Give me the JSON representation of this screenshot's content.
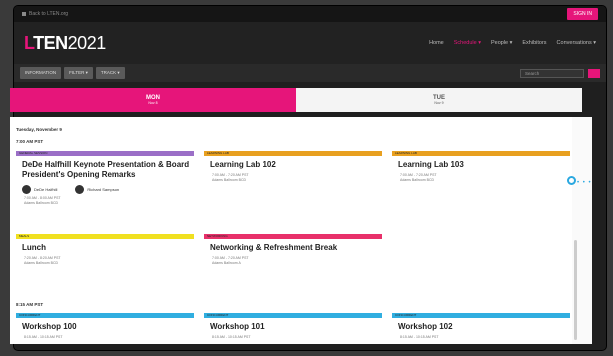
{
  "topbar": {
    "site_label": "Back to LTEN.org",
    "signin_label": "SIGN IN"
  },
  "logo": {
    "prefix": "LTEN",
    "year": "2021"
  },
  "nav": {
    "items": [
      "Home",
      "Schedule ▾",
      "People ▾",
      "Exhibitors",
      "Conversations ▾"
    ]
  },
  "filters": {
    "buttons": [
      "INFORMATION",
      "FILTER ▾",
      "TRACK ▾"
    ],
    "search_placeholder": "Search"
  },
  "days": [
    {
      "label": "MON",
      "sub": "Nov 8"
    },
    {
      "label": "TUE",
      "sub": "Nov 9"
    }
  ],
  "schedule": {
    "date_header": "Tuesday, November 9",
    "time1": "7:00 AM PST",
    "time2": "8:15 AM PST",
    "cards": [
      {
        "tag": "GENERAL SESSION",
        "color": "#9b6fc7",
        "title": "DeDe Halfhill Keynote Presentation & Board President's Opening Remarks",
        "speakers": [
          "DeDe Halfhill",
          "Richard Sampson"
        ],
        "time": "7:00 AM - 8:00 AM PST",
        "room": "Adams Ballroom BCD"
      },
      {
        "tag": "LEARNING LAB",
        "color": "#e8a020",
        "title": "Learning Lab 102",
        "time": "7:00 AM - 7:20 AM PST",
        "room": "Adams Ballroom BCD"
      },
      {
        "tag": "LEARNING LAB",
        "color": "#e8a020",
        "title": "Learning Lab 103",
        "time": "7:00 AM - 7:20 AM PST",
        "room": "Adams Ballroom BCD"
      },
      {
        "tag": "MEALS",
        "color": "#f0e020",
        "title": "Lunch",
        "time": "7:20 AM - 8:20 AM PST",
        "room": "Adams Ballroom BCD"
      },
      {
        "tag": "NETWORKING",
        "color": "#e8306a",
        "title": "Networking & Refreshment Break",
        "time": "7:00 AM - 7:20 AM PST",
        "room": "Adams Ballroom A"
      },
      {
        "tag": "CONCURRENT",
        "color": "#30aee0",
        "title": "Workshop 100",
        "time": "8:15 AM - 10:15 AM PST",
        "room": ""
      },
      {
        "tag": "CONCURRENT",
        "color": "#30aee0",
        "title": "Workshop 101",
        "time": "8:15 AM - 10:15 AM PST",
        "room": ""
      },
      {
        "tag": "CONCURRENT",
        "color": "#30aee0",
        "title": "Workshop 102",
        "time": "8:15 AM - 10:15 AM PST",
        "room": ""
      }
    ]
  },
  "colors": {
    "accent": "#e6157a",
    "pointer": "#2aa8e0"
  }
}
